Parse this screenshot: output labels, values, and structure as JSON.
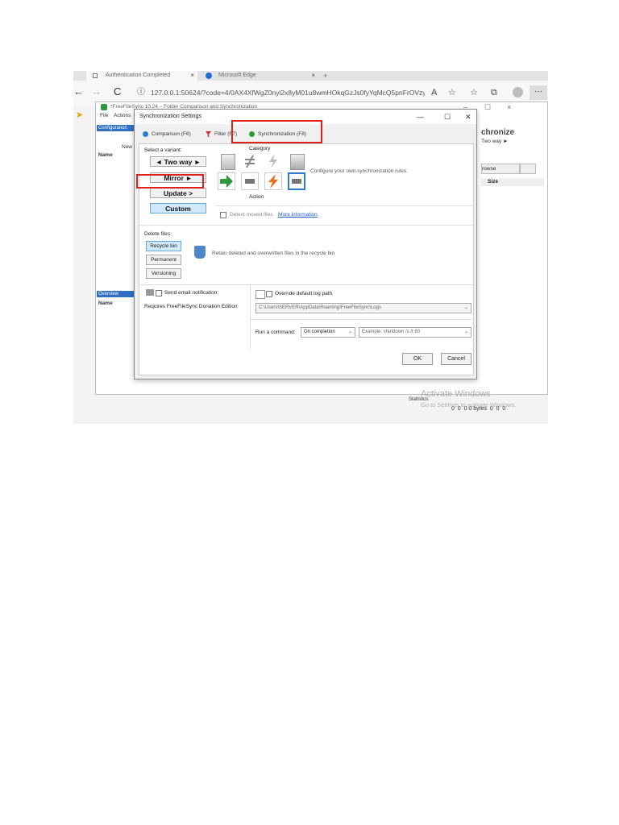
{
  "browser": {
    "tabs": [
      {
        "label": "Authentication Completed"
      },
      {
        "label": "Microsoft Edge"
      }
    ],
    "tab_close": "×",
    "new_tab": "+",
    "url": "127.0.0.1:50624/?code=4/0AX4XfWgZ0nyi2x8yM01u8wmHOkqGzJs0fyYqMcQ5pnFrOVzy0...",
    "nav": {
      "back": "←",
      "forward": "→",
      "reload": "C"
    },
    "toolbar": {
      "read_aloud": "A",
      "favorite": "☆",
      "favorites": "☆",
      "collections": "⧉",
      "more": "···"
    }
  },
  "app": {
    "title": "*FreeFileSync 10.24 – Folder Comparison and Synchronization",
    "menu": [
      "File",
      "Actions"
    ],
    "config_label": "Configuration",
    "new_label": "New",
    "name_col": "Name",
    "overview_label": "Overview",
    "overview_name_col": "Name",
    "sync_big": "chronize",
    "sync_mode": "Two way ►",
    "browse_label": "rowse",
    "size_col": "Size",
    "status_row": "0  0  0 0 bytes  0  0  0",
    "status_label": "Statistics:",
    "watermark_title": "Activate Windows",
    "watermark_sub": "Go to Settings to activate Windows.",
    "window_controls": {
      "min": "–",
      "max": "☐",
      "close": "×"
    },
    "outer_close": "×"
  },
  "dialog": {
    "title": "Synchronization Settings",
    "controls": {
      "min": "—",
      "max": "☐",
      "close": "✕"
    },
    "tabs": [
      {
        "label": "Comparison (F6)",
        "color": "#2a7bd1"
      },
      {
        "label": "Filter (F7)",
        "color": "#d42a2a"
      },
      {
        "label": "Synchronization (F8)",
        "color": "#2e9a3a"
      }
    ],
    "select_variant": "Select a variant:",
    "variants": [
      "◄ Two way ►",
      "Mirror ►",
      "Update >",
      "Custom"
    ],
    "category_label": "Category",
    "action_label": "Action",
    "config_text": "Configure your own synchronization rules.",
    "detect_moved": "Detect moved files",
    "more_info": "More information",
    "delete_files": "Delete files:",
    "delete_options": [
      "Recycle bin",
      "Permanent",
      "Versioning"
    ],
    "delete_desc": "Retain deleted and overwritten files in the recycle bin",
    "email_label": "Send email notification:",
    "donation_note": "Requires FreeFileSync Donation Edition",
    "override_log": "Override default log path:",
    "log_path": "C:\\Users\\SERVER\\AppData\\Roaming\\FreeFileSync\\Logs",
    "run_command": "Run a command:",
    "run_when": "On completion",
    "run_example": "Example: shutdown /s /t 60",
    "dropdown_arrow": "⌄",
    "ok": "OK",
    "cancel": "Cancel"
  },
  "colors": {
    "highlight_red": "#e0201a",
    "selected_blue": "#cfe8fb",
    "accent_blue": "#2f6fc4"
  }
}
